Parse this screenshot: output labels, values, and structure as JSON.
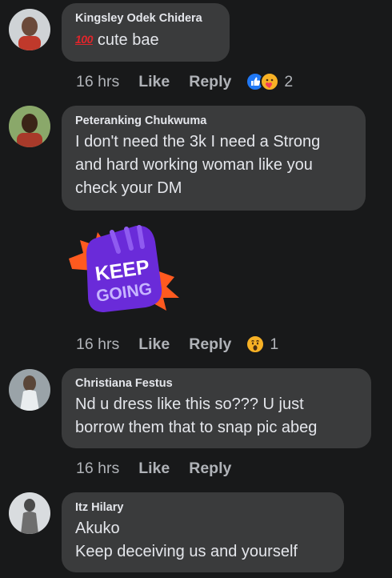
{
  "comments": [
    {
      "author": "Kingsley Odek Chidera",
      "emoji_prefix": "100",
      "text": "cute bae",
      "time": "16 hrs",
      "like": "Like",
      "reply": "Reply",
      "reactions": [
        "like-reaction",
        "care-reaction"
      ],
      "reaction_count": "2"
    },
    {
      "author": "Peteranking Chukwuma",
      "text": "I don't need the 3k I need a Strong\nand hard working woman like you\ncheck your DM",
      "sticker": {
        "line1": "KEEP",
        "line2": "GOING"
      },
      "time": "16 hrs",
      "like": "Like",
      "reply": "Reply",
      "reactions": [
        "wow-reaction"
      ],
      "reaction_count": "1"
    },
    {
      "author": "Christiana Festus",
      "text": "Nd u dress like this so???  U just\nborrow them that to snap pic abeg",
      "time": "16 hrs",
      "like": "Like",
      "reply": "Reply"
    },
    {
      "author": "Itz Hilary",
      "text": "Akuko\nKeep deceiving us and yourself"
    }
  ],
  "colors": {
    "background": "#18191a",
    "bubble": "#3a3b3c",
    "text": "#e4e6eb",
    "muted": "#b0b3b8",
    "like_blue": "#2078f4",
    "sticker_purple": "#6a2bd9",
    "sticker_orange": "#ff5a1f"
  }
}
